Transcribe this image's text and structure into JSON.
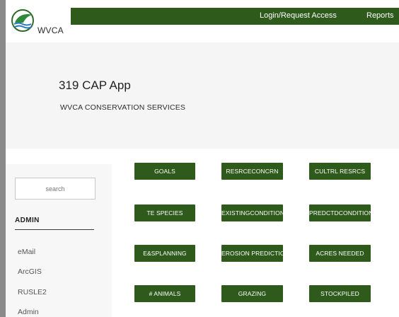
{
  "brand": {
    "name": "WVCA"
  },
  "topnav": {
    "login": "Login/Request Access",
    "reports": "Reports"
  },
  "hero": {
    "title": "319 CAP App",
    "subtitle": "WVCA CONSERVATION SERVICES"
  },
  "sidebar": {
    "search_placeholder": "search",
    "heading": "ADMIN",
    "items": [
      {
        "label": "eMail"
      },
      {
        "label": "ArcGIS"
      },
      {
        "label": "RUSLE2"
      },
      {
        "label": "Admin"
      }
    ]
  },
  "grid": {
    "buttons": [
      {
        "label": "GOALS"
      },
      {
        "label": "RESRCECONCRN"
      },
      {
        "label": "CULTRL RESRCS"
      },
      {
        "label": "TE SPECIES"
      },
      {
        "label": "EXISTINGCONDITION"
      },
      {
        "label": "PREDCTDCONDITION"
      },
      {
        "label": "E&SPLANNING"
      },
      {
        "label": "EROSION PREDICTION"
      },
      {
        "label": "ACRES NEEDED"
      },
      {
        "label": "# ANIMALS"
      },
      {
        "label": "GRAZING"
      },
      {
        "label": "STOCKPILED"
      }
    ]
  },
  "colors": {
    "primary_green": "#2e5a1c",
    "hero_bg": "#f5f5f5",
    "sidebar_bg": "#f7f7f7"
  }
}
